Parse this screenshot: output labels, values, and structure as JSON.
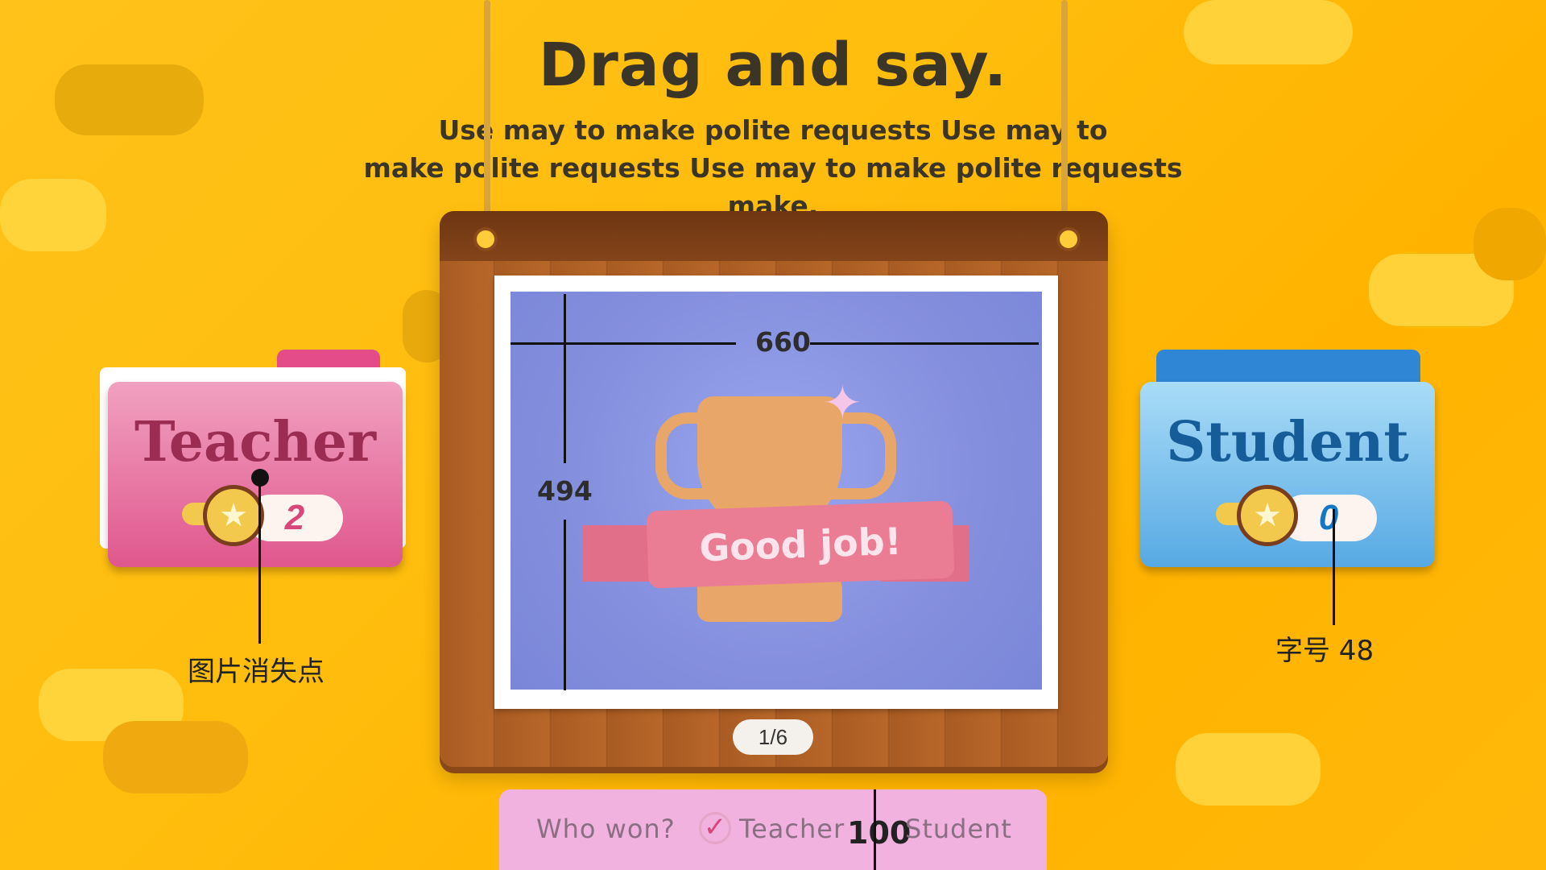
{
  "header": {
    "title": "Drag and say.",
    "subtitle_line1": "Use may to make polite requests Use may to",
    "subtitle_line2": "make polite requests Use may to make polite requests make."
  },
  "board": {
    "image_caption": "Good job!",
    "width_label": "660",
    "height_label": "494",
    "page_indicator": "1/6"
  },
  "teacher": {
    "label": "Teacher",
    "score": "2",
    "color": "#e4578f",
    "icon": "star-medal-icon"
  },
  "student": {
    "label": "Student",
    "score": "0",
    "color": "#56a8e3",
    "icon": "star-medal-icon"
  },
  "annotations": {
    "vanish_point": "图片消失点",
    "font_size": "字号 48"
  },
  "bottom_panel": {
    "question": "Who won?",
    "teacher_label": "Teacher",
    "mark": "100",
    "student_label": "Student",
    "icon": "checkmark-icon"
  },
  "colors": {
    "background": "#ffbd0d",
    "board": "#b2642a",
    "photo_bg": "#8590de",
    "banner": "#ea7c94",
    "bottom_panel": "#f1b2e0"
  }
}
